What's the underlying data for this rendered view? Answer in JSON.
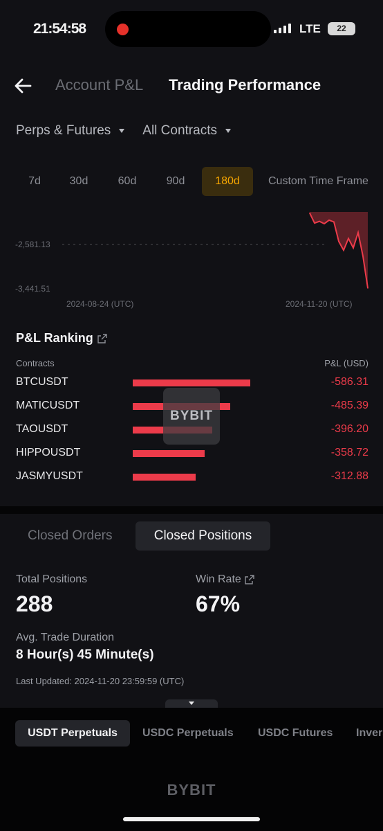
{
  "status_bar": {
    "time": "21:54:58",
    "carrier": "LTE",
    "battery": "22"
  },
  "header": {
    "tabs": [
      {
        "label": "Account P&L",
        "active": false
      },
      {
        "label": "Trading Performance",
        "active": true
      }
    ]
  },
  "filters": {
    "product": "Perps & Futures",
    "contracts": "All Contracts"
  },
  "periods": [
    "7d",
    "30d",
    "60d",
    "90d",
    "180d",
    "Custom Time Frame"
  ],
  "active_period": "180d",
  "chart_data": {
    "type": "area",
    "y_ticks": [
      "-2,581.13",
      "-3,441.51"
    ],
    "x_ticks": [
      "2024-08-24 (UTC)",
      "2024-11-20 (UTC)"
    ],
    "ylim": [
      -3441.51,
      -2150
    ],
    "color": "#ec3b4a",
    "x": [
      "2024-11-08",
      "2024-11-09",
      "2024-11-10",
      "2024-11-11",
      "2024-11-12",
      "2024-11-13",
      "2024-11-14",
      "2024-11-15",
      "2024-11-16",
      "2024-11-17",
      "2024-11-18",
      "2024-11-19",
      "2024-11-20"
    ],
    "values": [
      -2170,
      -2340,
      -2310,
      -2350,
      -2290,
      -2320,
      -2650,
      -2800,
      -2600,
      -2760,
      -2500,
      -2900,
      -3441.51
    ]
  },
  "ranking": {
    "title": "P&L Ranking",
    "col_contract": "Contracts",
    "col_pnl": "P&L (USD)",
    "rows": [
      {
        "name": "BTCUSDT",
        "value": "-586.31",
        "amount": 586.31
      },
      {
        "name": "MATICUSDT",
        "value": "-485.39",
        "amount": 485.39
      },
      {
        "name": "TAOUSDT",
        "value": "-396.20",
        "amount": 396.2
      },
      {
        "name": "HIPPOUSDT",
        "value": "-358.72",
        "amount": 358.72
      },
      {
        "name": "JASMYUSDT",
        "value": "-312.88",
        "amount": 312.88
      }
    ]
  },
  "watermark": "BYBIT",
  "subtabs": {
    "orders": "Closed Orders",
    "positions": "Closed Positions"
  },
  "stats": {
    "total_label": "Total Positions",
    "total_value": "288",
    "winrate_label": "Win Rate",
    "winrate_value": "67%",
    "duration_label": "Avg. Trade Duration",
    "duration_value": "8 Hour(s) 45 Minute(s)",
    "updated": "Last Updated: 2024-11-20 23:59:59 (UTC)"
  },
  "product_tabs": [
    "USDT Perpetuals",
    "USDC Perpetuals",
    "USDC Futures",
    "Inverse"
  ],
  "footer_logo": "BYBIT"
}
